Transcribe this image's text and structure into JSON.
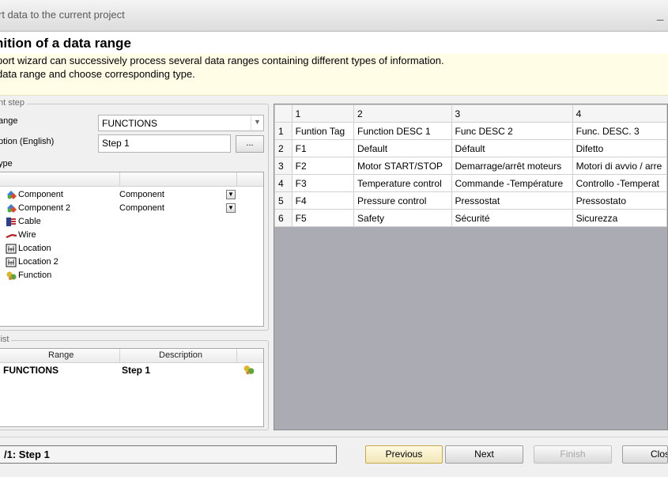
{
  "window": {
    "title": "rt data to the current project",
    "close_glyph": "_"
  },
  "header": {
    "title": "nition of a data range",
    "line1": "port wizard can successively process several data ranges containing different types of information.",
    "line2": "data range and choose corresponding type."
  },
  "step_group": {
    "title": "nt step",
    "range_label": "ange",
    "range_value": "FUNCTIONS",
    "description_label": "ption (English)",
    "description_value": "Step 1",
    "browse_label": "...",
    "type_label": "ype"
  },
  "types": [
    {
      "name": "Component",
      "sub": "Component",
      "has_dropdown": true,
      "icon": "component-icon"
    },
    {
      "name": "Component 2",
      "sub": "Component",
      "has_dropdown": true,
      "icon": "component-icon"
    },
    {
      "name": "Cable",
      "sub": "",
      "has_dropdown": false,
      "icon": "cable-icon"
    },
    {
      "name": "Wire",
      "sub": "",
      "has_dropdown": false,
      "icon": "wire-icon"
    },
    {
      "name": "Location",
      "sub": "",
      "has_dropdown": false,
      "icon": "location-icon"
    },
    {
      "name": "Location 2",
      "sub": "",
      "has_dropdown": false,
      "icon": "location-icon"
    },
    {
      "name": "Function",
      "sub": "",
      "has_dropdown": false,
      "icon": "function-icon"
    }
  ],
  "list_group": {
    "title": " list",
    "col_range": "Range",
    "col_description": "Description",
    "rows": [
      {
        "range": "FUNCTIONS",
        "description": "Step 1",
        "icon": "function-icon"
      }
    ]
  },
  "grid": {
    "columns": [
      "1",
      "2",
      "3",
      "4"
    ],
    "rows": [
      {
        "num": "1",
        "cells": [
          "Funtion Tag",
          "Function DESC 1",
          "Func DESC 2",
          "Func. DESC. 3"
        ]
      },
      {
        "num": "2",
        "cells": [
          "F1",
          "Default",
          "Défault",
          "Difetto"
        ]
      },
      {
        "num": "3",
        "cells": [
          "F2",
          "Motor START/STOP",
          "Demarrage/arrêt moteurs",
          "Motori di avvio / arre"
        ]
      },
      {
        "num": "4",
        "cells": [
          "F3",
          "Temperature control",
          "Commande -Température",
          "Controllo -Temperat"
        ]
      },
      {
        "num": "5",
        "cells": [
          "F4",
          "Pressure control",
          "Pressostat",
          "Pressostato"
        ]
      },
      {
        "num": "6",
        "cells": [
          "F5",
          "Safety",
          "Sécurité",
          "Sicurezza"
        ]
      }
    ]
  },
  "status": {
    "text": "/1: Step 1"
  },
  "buttons": {
    "previous": "Previous",
    "next": "Next",
    "finish": "Finish",
    "close": "Close"
  }
}
